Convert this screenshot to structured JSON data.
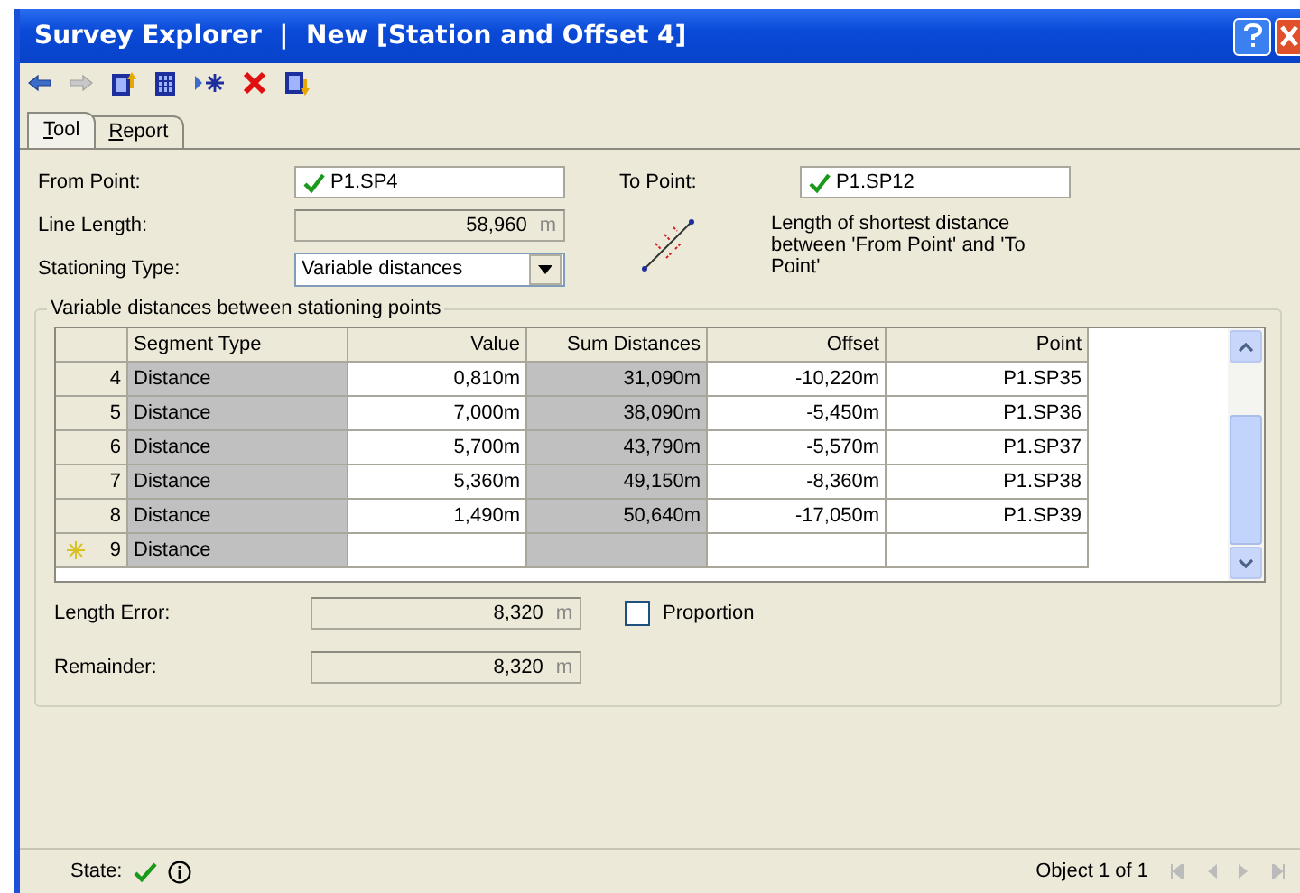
{
  "window": {
    "title": "Survey Explorer  |  New [Station and Offset 4]"
  },
  "tabs": [
    {
      "label": "Tool",
      "selected": true
    },
    {
      "label": "Report",
      "selected": false
    }
  ],
  "from_point": {
    "label": "From Point:",
    "value": "P1.SP4",
    "valid": true
  },
  "to_point": {
    "label": "To Point:",
    "value": "P1.SP12",
    "valid": true
  },
  "line_length": {
    "label": "Line Length:",
    "value": "58,960",
    "unit": "m"
  },
  "hint": "Length of shortest distance between 'From Point' and 'To Point'",
  "stationing_type": {
    "label": "Stationing Type:",
    "value": "Variable distances"
  },
  "group_title": "Variable distances between stationing points",
  "table": {
    "columns": [
      "Segment Type",
      "Value",
      "Sum Distances",
      "Offset",
      "Point"
    ],
    "rows": [
      {
        "index": "4",
        "new": false,
        "cells": [
          "Distance",
          "0,810m",
          "31,090m",
          "-10,220m",
          "P1.SP35"
        ]
      },
      {
        "index": "5",
        "new": false,
        "cells": [
          "Distance",
          "7,000m",
          "38,090m",
          "-5,450m",
          "P1.SP36"
        ]
      },
      {
        "index": "6",
        "new": false,
        "cells": [
          "Distance",
          "5,700m",
          "43,790m",
          "-5,570m",
          "P1.SP37"
        ]
      },
      {
        "index": "7",
        "new": false,
        "cells": [
          "Distance",
          "5,360m",
          "49,150m",
          "-8,360m",
          "P1.SP38"
        ]
      },
      {
        "index": "8",
        "new": false,
        "cells": [
          "Distance",
          "1,490m",
          "50,640m",
          "-17,050m",
          "P1.SP39"
        ]
      },
      {
        "index": "9",
        "new": true,
        "cells": [
          "Distance",
          "",
          "",
          "",
          ""
        ]
      }
    ]
  },
  "length_error": {
    "label": "Length Error:",
    "value": "8,320",
    "unit": "m"
  },
  "proportion": {
    "label": "Proportion",
    "checked": false
  },
  "remainder": {
    "label": "Remainder:",
    "value": "8,320",
    "unit": "m"
  },
  "status_bar": {
    "state_label": "State:",
    "object_text": "Object 1 of 1"
  }
}
